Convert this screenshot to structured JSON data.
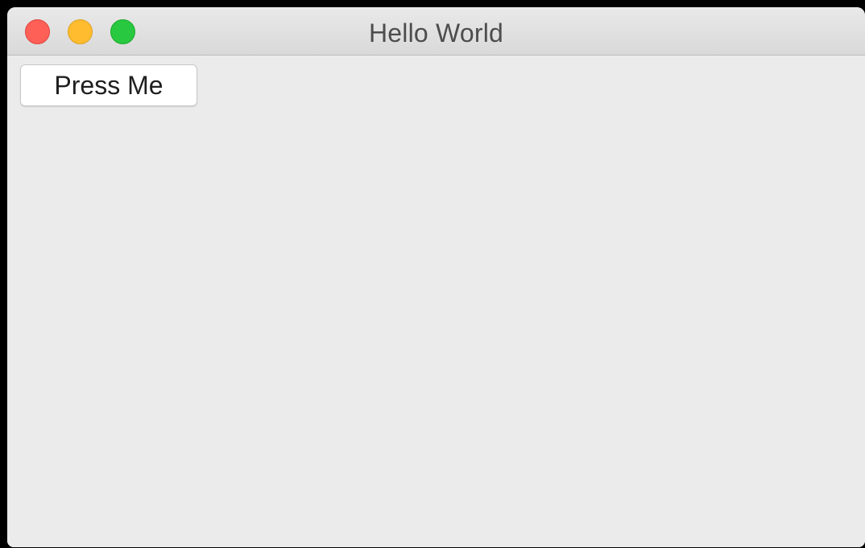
{
  "window": {
    "title": "Hello World"
  },
  "main": {
    "button_label": "Press Me"
  },
  "colors": {
    "close": "#fe5f57",
    "minimize": "#febc2e",
    "zoom": "#28c840",
    "window_background": "#ebebeb"
  },
  "icons": {
    "close": "close-traffic-light-icon",
    "minimize": "minimize-traffic-light-icon",
    "zoom": "zoom-traffic-light-icon"
  }
}
